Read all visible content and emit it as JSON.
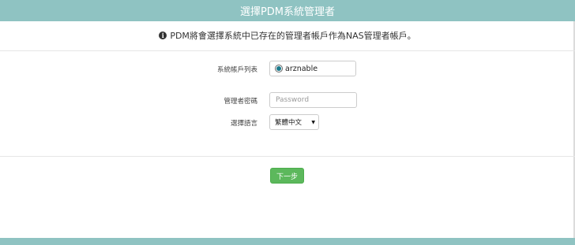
{
  "header": {
    "title": "選擇PDM系統管理者"
  },
  "info": {
    "icon": "info-circle-icon",
    "message": "PDM將會選擇系統中已存在的管理者帳戶作為NAS管理者帳戶。"
  },
  "form": {
    "account_list_label": "系統帳戶列表",
    "account_selected": "arznable",
    "password_label": "管理者密碼",
    "password_placeholder": "Password",
    "password_value": "",
    "language_label": "選擇語言",
    "language_selected": "繁體中文"
  },
  "actions": {
    "next_label": "下一步"
  },
  "colors": {
    "header_bg": "#8fc3c2",
    "button_bg": "#5cb85c",
    "radio_dot": "#1a7a8c"
  }
}
